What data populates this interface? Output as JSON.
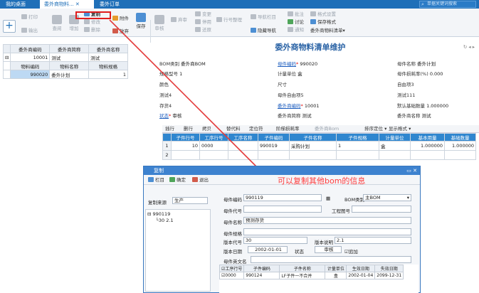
{
  "tabs": {
    "tab1": "我的桌面",
    "tab2": "委外商物料...",
    "tab3": "委外订单",
    "search_placeholder": "单据关键词搜索"
  },
  "toolbar": {
    "print": "打印",
    "export": "输出",
    "view": "查阅",
    "add": "增加",
    "copy": "复制",
    "edit": "修改",
    "delete": "删除",
    "attach": "附件",
    "release": "放弃",
    "save": "保存",
    "audit": "审核",
    "unaudit": "弃审",
    "change": "变更",
    "stop": "停用",
    "restore": "还原",
    "line_tidy": "行号整理",
    "nav": "导航栏目",
    "hide_nav": "隐藏导航",
    "remark": "批注",
    "discuss": "讨论",
    "notify": "通知",
    "format_set": "格式设置",
    "save_format": "保存格式",
    "format_name": "委外商物料清单▾"
  },
  "left_table": {
    "headers": [
      "委外商编码",
      "委外商简称",
      "委外商名称"
    ],
    "row": [
      "10001",
      "测试",
      "测试"
    ],
    "sub_headers": [
      "物料编码",
      "物料名称",
      "物料规格"
    ],
    "sub_row": [
      "990020",
      "委外计划",
      "1"
    ]
  },
  "form": {
    "title": "委外商物料清单维护",
    "bom_type_lbl": "BOM类别",
    "bom_type": "委外商BOM",
    "spec_lbl": "规格型号",
    "spec": "1",
    "color_lbl": "颜色",
    "test4_lbl": "测试4",
    "stock4_lbl": "存货4",
    "status_lbl": "状态",
    "status": "审核",
    "parent_code_lbl": "母件编码",
    "parent_code": "990020",
    "unit_lbl": "计量单位",
    "unit": "盒",
    "size_lbl": "尺寸",
    "free5_lbl": "母件自由项5",
    "vendor_code_lbl": "委外商编码",
    "vendor_code": "10001",
    "vendor_short_lbl": "委外商简称",
    "vendor_short": "测试",
    "parent_name_lbl": "母件名称",
    "parent_name": "委外计划",
    "loss_lbl": "母件损耗率(%)",
    "loss": "0.000",
    "free3_lbl": "自由项3",
    "test111_lbl": "测试111",
    "base_qty_lbl": "默认基础数量",
    "base_qty": "1.000000",
    "vendor_name_lbl": "委外商名称",
    "vendor_name": "测试"
  },
  "grid_toolbar": {
    "insert": "插行",
    "del_row": "删行",
    "copy_row": "拷贝",
    "substitute": "替代料",
    "locate": "定位符",
    "step_loss": "阶梯损耗率",
    "vendor_bom": "委外商Bom",
    "sort": "排序定位 ▾",
    "display": "显示格式 ▾"
  },
  "grid": {
    "headers": [
      "",
      "子件行号",
      "工序行号",
      "工序名称",
      "子件编码",
      "子件名称",
      "子件规格",
      "计量单位",
      "基本用量",
      "基础数量"
    ],
    "row1": [
      "1",
      "10",
      "0000",
      "",
      "990019",
      "采购计划",
      "1",
      "盒",
      "1.000000",
      "1.000000"
    ],
    "row2_num": "2"
  },
  "dialog": {
    "title": "复制",
    "col_btn": "栏目",
    "ok_btn": "确定",
    "exit_btn": "退出",
    "source_lbl": "复制来源",
    "source": "生产",
    "tree_root": "990119",
    "tree_child": "30 2.1",
    "parent_code_lbl": "母件编码",
    "parent_code": "990119",
    "bom_type_lbl": "BOM类别",
    "bom_type": "主BOM",
    "parent_no_lbl": "母件代号",
    "drawing_lbl": "工程图号",
    "parent_name_lbl": "母件名称",
    "parent_name": "预测存货",
    "parent_spec_lbl": "母件规格",
    "ver_code_lbl": "版本代号",
    "ver_code": "30",
    "ver_desc_lbl": "版本说明",
    "ver_desc": "2.1",
    "ver_date_lbl": "版本日期",
    "ver_date": "2002-01-01",
    "status_lbl": "状态",
    "status": "审核",
    "add_lbl": "追加",
    "en_name_lbl": "母件英文名",
    "child_headers": [
      "工序行号",
      "子件编码",
      "子件名称",
      "计量单位",
      "生效日期",
      "失效日期"
    ],
    "child_row": [
      "0000",
      "990124",
      "LF子件一不合并",
      "盒",
      "2002-01-04",
      "2099-12-31"
    ]
  },
  "annotation": "可以复制其他bom的信息"
}
